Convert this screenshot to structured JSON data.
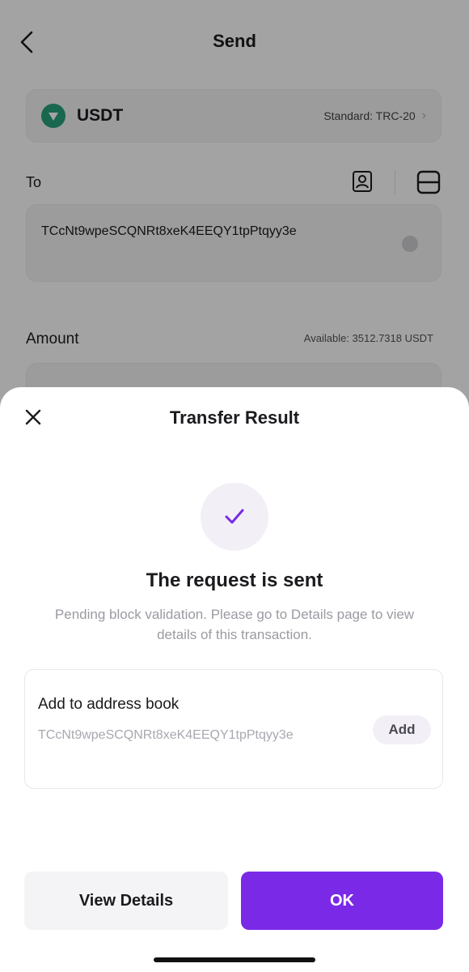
{
  "background_screen": {
    "title": "Send",
    "token": {
      "symbol": "USDT",
      "standard": "Standard: TRC-20"
    },
    "to_label": "To",
    "address": "TCcNt9wpeSCQNRt8xeK4EEQY1tpPtqyy3e",
    "amount_label": "Amount",
    "available": "Available: 3512.7318 USDT"
  },
  "sheet": {
    "title": "Transfer Result",
    "headline": "The request is sent",
    "description": "Pending block validation. Please go to Details page to view details of this transaction.",
    "address_book": {
      "title": "Add to address book",
      "address": "TCcNt9wpeSCQNRt8xeK4EEQY1tpPtqyy3e",
      "add_label": "Add"
    },
    "buttons": {
      "view_details": "View Details",
      "ok": "OK"
    }
  },
  "colors": {
    "accent": "#7a2ae6",
    "token_green": "#26a17b",
    "muted_text": "#9a9aa2"
  },
  "icons": [
    "back-icon",
    "tether-icon",
    "contact-book-icon",
    "scan-icon",
    "close-icon",
    "checkmark-icon"
  ]
}
